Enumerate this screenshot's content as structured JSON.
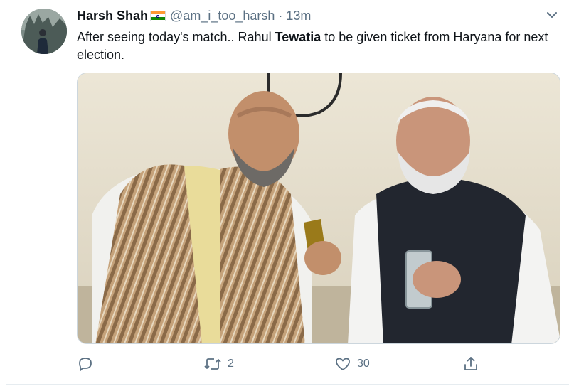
{
  "tweet": {
    "author": {
      "name": "Harsh Shah",
      "handle": "@am_i_too_harsh",
      "separator": "·",
      "time": "13m",
      "avatar_icon": "profile-avatar",
      "flag_icon": "india-flag-emoji"
    },
    "text_before": "After seeing today's match.. Rahul ",
    "text_bold": "Tewatia",
    "text_after": " to be given ticket from Haryana for next election.",
    "media": {
      "kind": "photo",
      "description": "two-men-looking-at-phone-photo"
    },
    "actions": {
      "reply": {
        "icon": "reply-icon",
        "count": ""
      },
      "retweet": {
        "icon": "retweet-icon",
        "count": "2"
      },
      "like": {
        "icon": "heart-icon",
        "count": "30"
      },
      "share": {
        "icon": "share-icon",
        "count": ""
      }
    },
    "menu_icon": "chevron-down-icon",
    "colors": {
      "text": "#0f1419",
      "secondary": "#5b7083",
      "border": "#ccd6dd",
      "divider": "#e6ecf0"
    }
  }
}
